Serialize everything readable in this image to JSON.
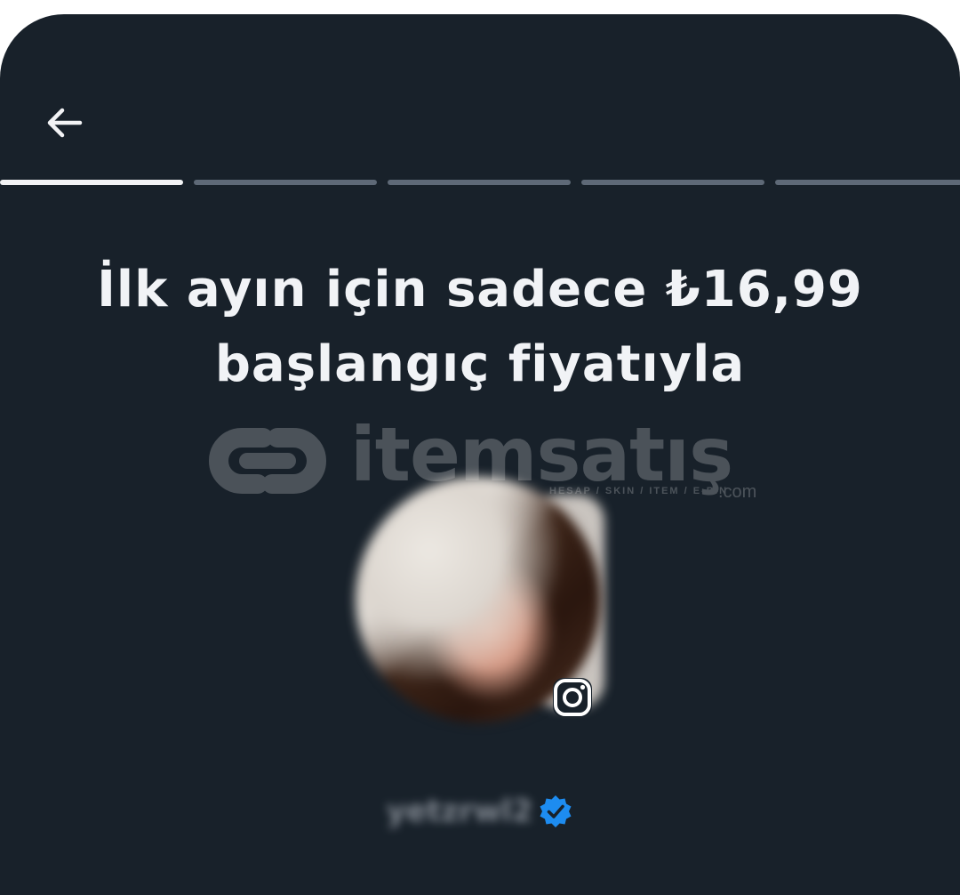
{
  "header": {
    "back_icon": "arrow-left-icon"
  },
  "progress": {
    "total_steps": 5,
    "current_step": 1
  },
  "headline": {
    "line1": "İlk ayın için sadece ₺16,99",
    "line2": "başlangıç fiyatıyla"
  },
  "watermark": {
    "brand": "itemsatış",
    "tagline": "HESAP / SKIN / ITEM / E-PIN",
    "domain": ".com"
  },
  "profile": {
    "avatar_icon": "profile-photo",
    "platform_icon": "instagram-icon",
    "username": "yetzrwl2",
    "verified_icon": "verified-badge-icon"
  },
  "colors": {
    "background": "#18212a",
    "progress_active": "#f2f3f5",
    "progress_inactive": "#5e6977",
    "verified": "#1d8cf0",
    "text": "#f1f3f6"
  }
}
